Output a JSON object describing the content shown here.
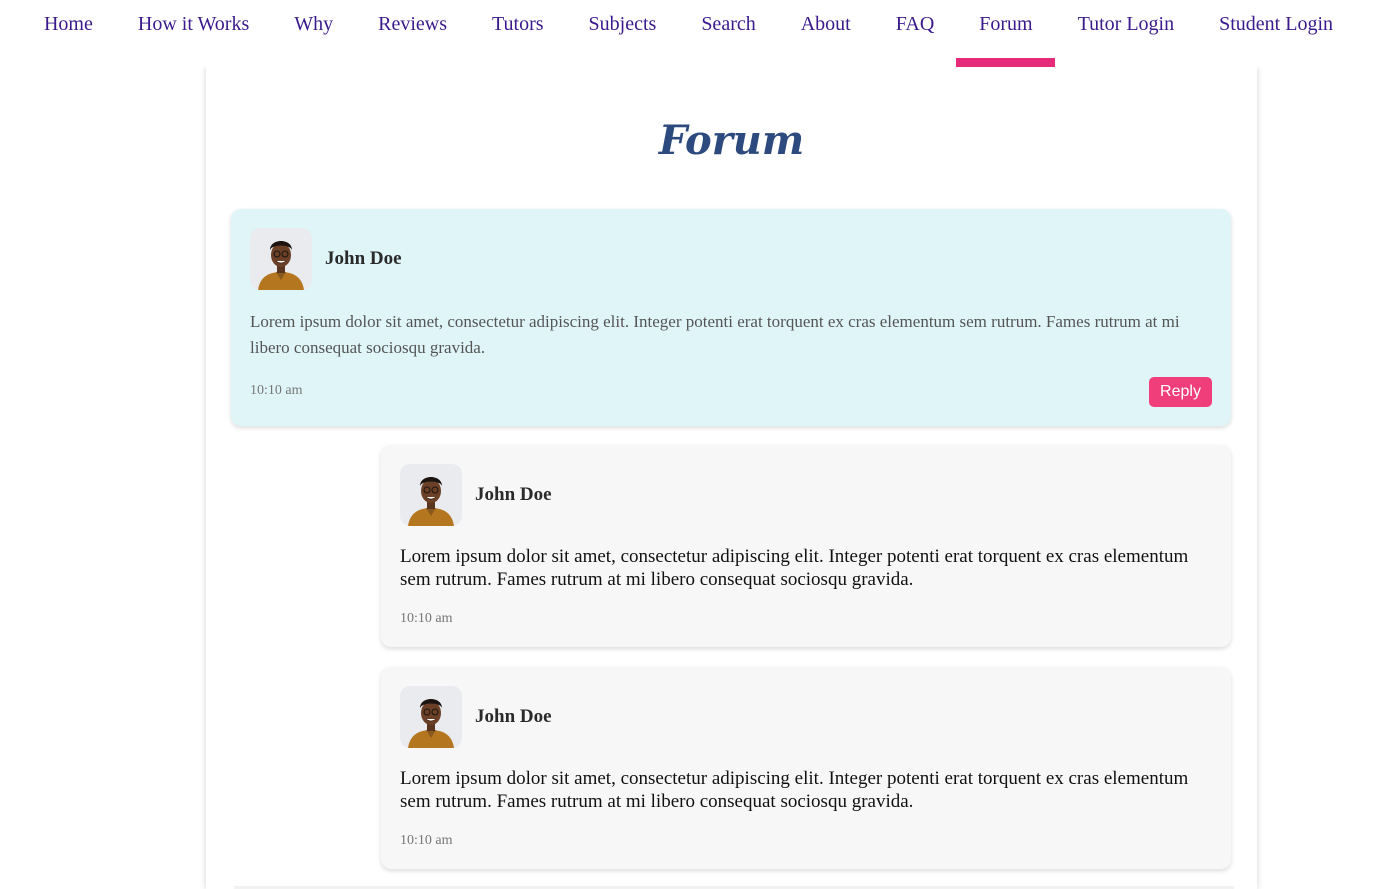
{
  "nav": {
    "items": [
      {
        "label": "Home"
      },
      {
        "label": "How it Works"
      },
      {
        "label": "Why"
      },
      {
        "label": "Reviews"
      },
      {
        "label": "Tutors"
      },
      {
        "label": "Subjects"
      },
      {
        "label": "Search"
      },
      {
        "label": "About"
      },
      {
        "label": "FAQ"
      },
      {
        "label": "Forum",
        "active": true
      },
      {
        "label": "Tutor Login"
      },
      {
        "label": "Student Login"
      }
    ]
  },
  "page": {
    "title": "Forum"
  },
  "colors": {
    "nav_text": "#3a1a8c",
    "active_underline": "#e62b7a",
    "title": "#2c4a7e",
    "main_post_bg": "#dff5f8",
    "reply_bg": "#f7f7f7",
    "reply_button": "#f03e7b"
  },
  "posts": [
    {
      "author": "John Doe",
      "text": "Lorem ipsum dolor sit amet, consectetur adipiscing elit. Integer potenti erat torquent ex cras elementum sem rutrum. Fames rutrum at mi libero consequat sociosqu gravida.",
      "time": "10:10 am",
      "reply_label": "Reply",
      "replies": [
        {
          "author": "John Doe",
          "text": "Lorem ipsum dolor sit amet, consectetur adipiscing elit. Integer potenti erat torquent ex cras elementum sem rutrum. Fames rutrum at mi libero consequat sociosqu gravida.",
          "time": "10:10 am"
        },
        {
          "author": "John Doe",
          "text": "Lorem ipsum dolor sit amet, consectetur adipiscing elit. Integer potenti erat torquent ex cras elementum sem rutrum. Fames rutrum at mi libero consequat sociosqu gravida.",
          "time": "10:10 am"
        }
      ]
    }
  ]
}
